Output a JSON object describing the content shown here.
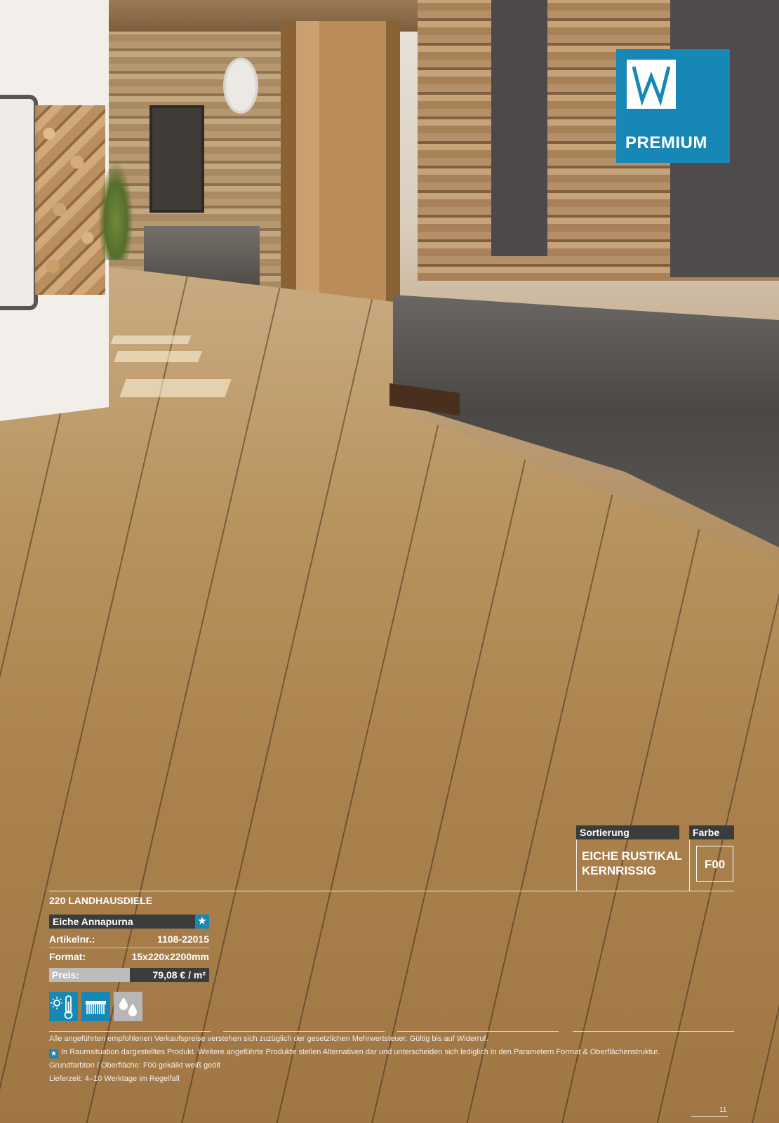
{
  "badge": {
    "label": "PREMIUM",
    "color": "#1788b5",
    "logo_icon": "w-logo-icon"
  },
  "sortierung": {
    "header": "Sortierung",
    "line1": "EICHE RUSTIKAL",
    "line2": "KERNRISSIG"
  },
  "farbe": {
    "header": "Farbe",
    "value": "F00"
  },
  "product": {
    "series": "220 LANDHAUSDIELE",
    "name": "Eiche Annapurna",
    "star_icon": "star-icon",
    "artikel_label": "Artikelnr.:",
    "artikel_value": "1108-22015",
    "format_label": "Format:",
    "format_value": "15x220x2200mm",
    "preis_label": "Preis:",
    "preis_value": "79,08 € / m²",
    "icons": [
      "floor-heating-icon",
      "brush-texture-icon",
      "water-drops-icon"
    ]
  },
  "notes": {
    "line1": "Alle angeführten empfohlenen Verkaufspreise verstehen sich zuzüglich der gesetzlichen Mehrwertsteuer. Gültig bis auf Widerruf.",
    "line2": "In Raumsituation dargestelltes Produkt. Weitere angeführte Produkte stellen Alternativen dar und unterscheiden sich lediglich in den Parametern Format & Oberflächenstruktur.",
    "line3": "Grundfarbton / Oberfläche: F00 gekälkt weiß geölt",
    "line4": "Lieferzeit: 4–10 Werktage im Regelfall"
  },
  "page_number": "11"
}
